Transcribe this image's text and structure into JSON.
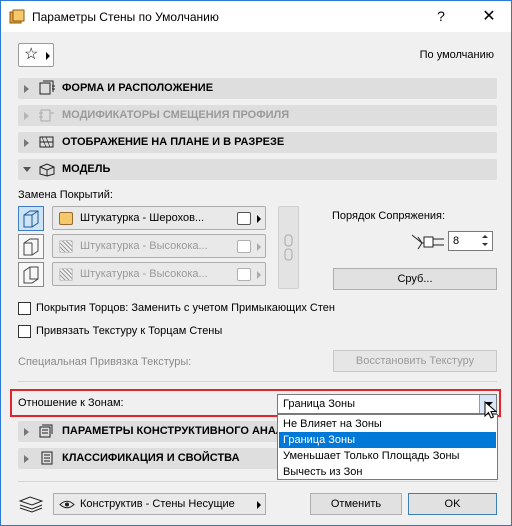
{
  "window": {
    "title": "Параметры Стены по Умолчанию",
    "help_label": "?",
    "close_label": "✕"
  },
  "header": {
    "favorites_icon": "star-icon",
    "defaults_label": "По умолчанию"
  },
  "panels": [
    {
      "label": "ФОРМА И РАСПОЛОЖЕНИЕ",
      "expanded": false,
      "enabled": true
    },
    {
      "label": "МОДИФИКАТОРЫ СМЕЩЕНИЯ ПРОФИЛЯ",
      "expanded": false,
      "enabled": false
    },
    {
      "label": "ОТОБРАЖЕНИЕ НА ПЛАНЕ И В РАЗРЕЗЕ",
      "expanded": false,
      "enabled": true
    },
    {
      "label": "МОДЕЛЬ",
      "expanded": true,
      "enabled": true
    }
  ],
  "model": {
    "surface_override_label": "Замена Покрытий:",
    "surfaces": [
      {
        "name": "Штукатурка - Шерохов...",
        "enabled": true
      },
      {
        "name": "Штукатурка - Высокока...",
        "enabled": false
      },
      {
        "name": "Штукатурка - Высокока...",
        "enabled": false
      }
    ],
    "junction_order_label": "Порядок Сопряжения:",
    "junction_order_value": "8",
    "log_button": "Сруб...",
    "edge_surfaces_label": "Покрытия Торцов: Заменить с учетом Примыкающих Стен",
    "edge_surfaces_checked": false,
    "align_texture_label": "Привязать Текстуру к Торцам Стены",
    "align_texture_checked": false,
    "custom_texture_label": "Специальная Привязка Текстуры:",
    "reset_texture_button": "Восстановить Текстуру"
  },
  "zones": {
    "label": "Отношение к Зонам:",
    "value": "Граница Зоны",
    "options": [
      "Не Влияет на Зоны",
      "Граница Зоны",
      "Уменьшает Только Площадь Зоны",
      "Вычесть из Зон"
    ],
    "selected_index": 1
  },
  "panels_bottom": [
    {
      "label": "ПАРАМЕТРЫ КОНСТРУКТИВНОГО АНАЛ"
    },
    {
      "label": "КЛАССИФИКАЦИЯ И СВОЙСТВА"
    }
  ],
  "footer": {
    "layer_value": "Конструктив - Стены Несущие",
    "cancel_button": "Отменить",
    "ok_button": "OK"
  },
  "colors": {
    "accent": "#0078d7",
    "highlight_border": "#e0262b",
    "surface_swatch": "#f6c86c"
  }
}
